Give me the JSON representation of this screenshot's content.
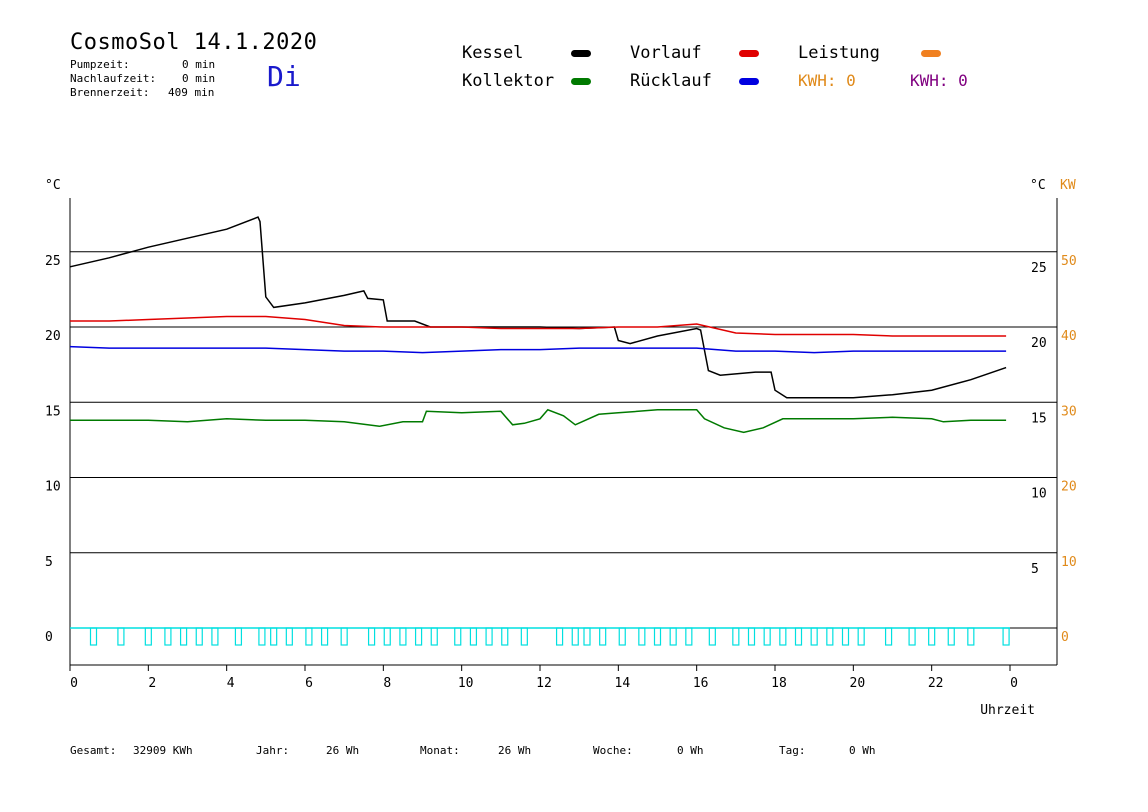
{
  "header": {
    "title": "CosmoSol 14.1.2020",
    "day": "Di",
    "pump_label": "Pumpzeit:",
    "pump_value": "0 min",
    "nachlauf_label": "Nachlaufzeit:",
    "nachlauf_value": "0 min",
    "brenner_label": "Brennerzeit:",
    "brenner_value": "409 min"
  },
  "legend": {
    "kessel": "Kessel",
    "kollektor": "Kollektor",
    "vorlauf": "Vorlauf",
    "ruecklauf": "Rücklauf",
    "leistung": "Leistung",
    "kwh_left": "KWH: 0",
    "kwh_right": "KWH: 0"
  },
  "colors": {
    "kessel": "#000000",
    "kollektor": "#007a00",
    "vorlauf": "#e00000",
    "ruecklauf": "#0000e0",
    "leistung": "#f08020",
    "pump": "#00e0e0",
    "kwh_left": "#e08a1a",
    "kwh_right": "#800080"
  },
  "footer": {
    "gesamt_label": "Gesamt:",
    "gesamt_value": "32909 KWh",
    "jahr_label": "Jahr:",
    "jahr_value": "26 Wh",
    "monat_label": "Monat:",
    "monat_value": "26 Wh",
    "woche_label": "Woche:",
    "woche_value": "0 Wh",
    "tag_label": "Tag:",
    "tag_value": "0 Wh"
  },
  "chart_data": {
    "type": "line",
    "xlabel": "Uhrzeit",
    "x_ticks": [
      "0",
      "2",
      "4",
      "6",
      "8",
      "10",
      "12",
      "14",
      "16",
      "18",
      "20",
      "22",
      "0"
    ],
    "xlim": [
      0,
      24
    ],
    "left_unit": "°C",
    "right_unit": "°C",
    "right2_unit": "KW",
    "ylim": [
      0,
      29
    ],
    "y_ticks_left": [
      "0",
      "5",
      "10",
      "15",
      "20",
      "25"
    ],
    "y_ticks_right": [
      "5",
      "10",
      "15",
      "20",
      "25"
    ],
    "y_ticks_right2": [
      "0",
      "10",
      "20",
      "30",
      "40",
      "50"
    ],
    "grid_y": [
      5,
      10,
      15,
      20,
      25
    ],
    "series": [
      {
        "name": "Kessel",
        "color": "#000000",
        "points": [
          [
            0,
            24.0
          ],
          [
            1,
            24.6
          ],
          [
            2,
            25.3
          ],
          [
            3,
            25.9
          ],
          [
            4,
            26.5
          ],
          [
            4.8,
            27.3
          ],
          [
            4.85,
            27.0
          ],
          [
            5.0,
            22.0
          ],
          [
            5.2,
            21.3
          ],
          [
            6,
            21.6
          ],
          [
            7,
            22.1
          ],
          [
            7.5,
            22.4
          ],
          [
            7.6,
            21.9
          ],
          [
            8.0,
            21.8
          ],
          [
            8.1,
            20.4
          ],
          [
            8.8,
            20.4
          ],
          [
            9.2,
            20.0
          ],
          [
            10,
            20.0
          ],
          [
            12,
            20.0
          ],
          [
            13,
            19.9
          ],
          [
            13.9,
            20.0
          ],
          [
            14.0,
            19.1
          ],
          [
            14.3,
            18.9
          ],
          [
            15,
            19.4
          ],
          [
            16,
            19.9
          ],
          [
            16.1,
            19.8
          ],
          [
            16.3,
            17.1
          ],
          [
            16.6,
            16.8
          ],
          [
            17.5,
            17.0
          ],
          [
            17.9,
            17.0
          ],
          [
            18.0,
            15.8
          ],
          [
            18.3,
            15.3
          ],
          [
            19,
            15.3
          ],
          [
            20,
            15.3
          ],
          [
            21,
            15.5
          ],
          [
            22,
            15.8
          ],
          [
            23,
            16.5
          ],
          [
            23.9,
            17.3
          ]
        ]
      },
      {
        "name": "Vorlauf",
        "color": "#e00000",
        "points": [
          [
            0,
            20.4
          ],
          [
            1,
            20.4
          ],
          [
            2,
            20.5
          ],
          [
            3,
            20.6
          ],
          [
            4,
            20.7
          ],
          [
            5,
            20.7
          ],
          [
            6,
            20.5
          ],
          [
            7,
            20.1
          ],
          [
            8,
            20.0
          ],
          [
            9,
            20.0
          ],
          [
            10,
            20.0
          ],
          [
            11,
            19.9
          ],
          [
            12,
            19.9
          ],
          [
            13,
            19.9
          ],
          [
            14,
            20.0
          ],
          [
            15,
            20.0
          ],
          [
            16,
            20.2
          ],
          [
            17,
            19.6
          ],
          [
            18,
            19.5
          ],
          [
            19,
            19.5
          ],
          [
            20,
            19.5
          ],
          [
            21,
            19.4
          ],
          [
            22,
            19.4
          ],
          [
            23,
            19.4
          ],
          [
            23.9,
            19.4
          ]
        ]
      },
      {
        "name": "Rücklauf",
        "color": "#0000e0",
        "points": [
          [
            0,
            18.7
          ],
          [
            1,
            18.6
          ],
          [
            2,
            18.6
          ],
          [
            3,
            18.6
          ],
          [
            4,
            18.6
          ],
          [
            5,
            18.6
          ],
          [
            6,
            18.5
          ],
          [
            7,
            18.4
          ],
          [
            8,
            18.4
          ],
          [
            9,
            18.3
          ],
          [
            10,
            18.4
          ],
          [
            11,
            18.5
          ],
          [
            12,
            18.5
          ],
          [
            13,
            18.6
          ],
          [
            14,
            18.6
          ],
          [
            15,
            18.6
          ],
          [
            16,
            18.6
          ],
          [
            17,
            18.4
          ],
          [
            18,
            18.4
          ],
          [
            19,
            18.3
          ],
          [
            20,
            18.4
          ],
          [
            21,
            18.4
          ],
          [
            22,
            18.4
          ],
          [
            23,
            18.4
          ],
          [
            23.9,
            18.4
          ]
        ]
      },
      {
        "name": "Kollektor",
        "color": "#007a00",
        "points": [
          [
            0,
            13.8
          ],
          [
            1,
            13.8
          ],
          [
            2,
            13.8
          ],
          [
            3,
            13.7
          ],
          [
            4,
            13.9
          ],
          [
            5,
            13.8
          ],
          [
            6,
            13.8
          ],
          [
            7,
            13.7
          ],
          [
            7.9,
            13.4
          ],
          [
            8.5,
            13.7
          ],
          [
            9.0,
            13.7
          ],
          [
            9.1,
            14.4
          ],
          [
            10,
            14.3
          ],
          [
            11,
            14.4
          ],
          [
            11.3,
            13.5
          ],
          [
            11.6,
            13.6
          ],
          [
            12,
            13.9
          ],
          [
            12.2,
            14.5
          ],
          [
            12.6,
            14.1
          ],
          [
            12.9,
            13.5
          ],
          [
            13.5,
            14.2
          ],
          [
            14,
            14.3
          ],
          [
            15,
            14.5
          ],
          [
            16,
            14.5
          ],
          [
            16.2,
            13.9
          ],
          [
            16.7,
            13.3
          ],
          [
            17.2,
            13.0
          ],
          [
            17.7,
            13.3
          ],
          [
            18.2,
            13.9
          ],
          [
            19,
            13.9
          ],
          [
            20,
            13.9
          ],
          [
            21,
            14.0
          ],
          [
            22,
            13.9
          ],
          [
            22.3,
            13.7
          ],
          [
            23,
            13.8
          ],
          [
            23.9,
            13.8
          ]
        ]
      },
      {
        "name": "Pumpe",
        "color": "#00e0e0",
        "baseline": 0,
        "pulses": [
          0.6,
          1.3,
          2.0,
          2.5,
          2.9,
          3.3,
          3.7,
          4.3,
          4.9,
          5.2,
          5.6,
          6.1,
          6.5,
          7.0,
          7.7,
          8.1,
          8.5,
          8.9,
          9.3,
          9.9,
          10.3,
          10.7,
          11.1,
          11.6,
          12.5,
          12.9,
          13.2,
          13.6,
          14.1,
          14.6,
          15.0,
          15.4,
          15.8,
          16.4,
          17.0,
          17.4,
          17.8,
          18.2,
          18.6,
          19.0,
          19.4,
          19.8,
          20.2,
          20.9,
          21.5,
          22.0,
          22.5,
          23.0,
          23.9
        ]
      }
    ]
  }
}
